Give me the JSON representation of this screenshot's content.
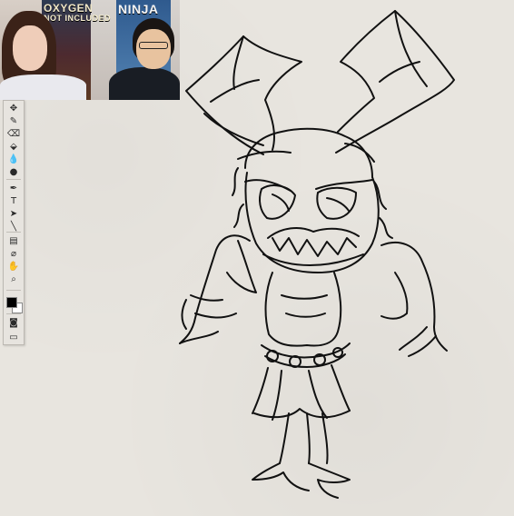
{
  "webcam": {
    "poster_left_line1": "OXYGEN",
    "poster_left_line2": "NOT INCLUDED",
    "poster_right_text": "NINJA"
  },
  "toolbar": {
    "tools": [
      {
        "name": "move-icon",
        "glyph": "✥"
      },
      {
        "name": "brush-icon",
        "glyph": "✎"
      },
      {
        "name": "eraser-icon",
        "glyph": "⌫"
      },
      {
        "name": "bucket-icon",
        "glyph": "⬙"
      },
      {
        "name": "drop-icon",
        "glyph": "💧"
      },
      {
        "name": "blur-icon",
        "glyph": "●"
      },
      {
        "name": "pen-icon",
        "glyph": "✒"
      },
      {
        "name": "text-icon",
        "glyph": "T"
      },
      {
        "name": "path-select-icon",
        "glyph": "➤"
      },
      {
        "name": "line-icon",
        "glyph": "╲"
      },
      {
        "name": "notes-icon",
        "glyph": "▤"
      },
      {
        "name": "eyedropper-icon",
        "glyph": "⌀"
      },
      {
        "name": "hand-icon",
        "glyph": "✋"
      },
      {
        "name": "zoom-icon",
        "glyph": "⌕"
      },
      {
        "name": "quickmask-icon",
        "glyph": "◙"
      },
      {
        "name": "screen-mode-icon",
        "glyph": "▭"
      }
    ]
  },
  "colors": {
    "background": "#e8e5df",
    "ink": "#111111",
    "foreground_swatch": "#000000",
    "background_swatch": "#ffffff"
  }
}
